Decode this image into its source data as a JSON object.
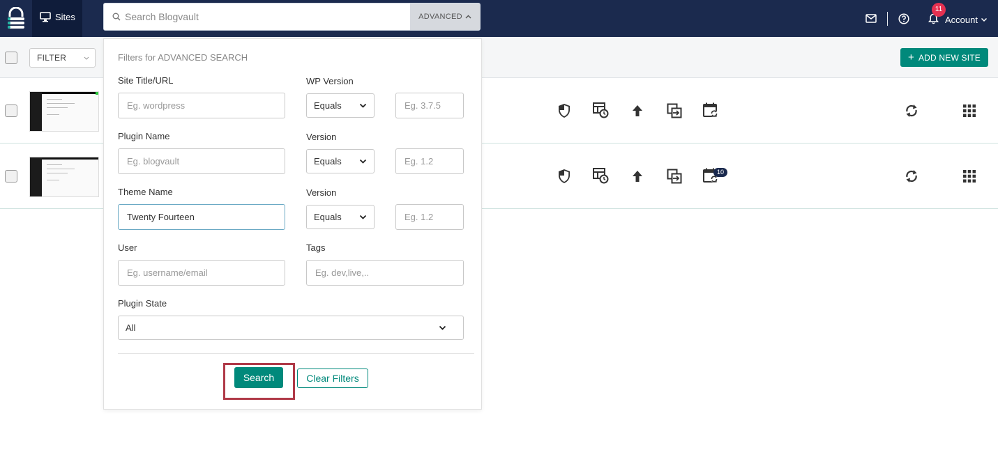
{
  "nav": {
    "sites_label": "Sites",
    "search_placeholder": "Search Blogvault",
    "advanced_label": "ADVANCED",
    "notification_count": "11",
    "account_label": "Account"
  },
  "toolbar": {
    "filter_label": "FILTER",
    "add_site_label": "ADD NEW SITE"
  },
  "sites": [
    {
      "calendar_badge": ""
    },
    {
      "calendar_badge": "10"
    }
  ],
  "advanced": {
    "title": "Filters for ADVANCED SEARCH",
    "site_title_label": "Site Title/URL",
    "site_title_placeholder": "Eg. wordpress",
    "wp_version_label": "WP Version",
    "wp_version_operator": "Equals",
    "wp_version_placeholder": "Eg. 3.7.5",
    "plugin_name_label": "Plugin Name",
    "plugin_name_placeholder": "Eg. blogvault",
    "plugin_version_label": "Version",
    "plugin_version_operator": "Equals",
    "plugin_version_placeholder": "Eg. 1.2",
    "theme_name_label": "Theme Name",
    "theme_name_value": "Twenty Fourteen",
    "theme_version_label": "Version",
    "theme_version_operator": "Equals",
    "theme_version_placeholder": "Eg. 1.2",
    "user_label": "User",
    "user_placeholder": "Eg. username/email",
    "tags_label": "Tags",
    "tags_placeholder": "Eg. dev,live,..",
    "plugin_state_label": "Plugin State",
    "plugin_state_value": "All",
    "search_button": "Search",
    "clear_button": "Clear Filters"
  },
  "colors": {
    "nav_bg": "#1b2a4e",
    "accent": "#00897b",
    "badge_red": "#e53151",
    "highlight": "#b03a48"
  }
}
